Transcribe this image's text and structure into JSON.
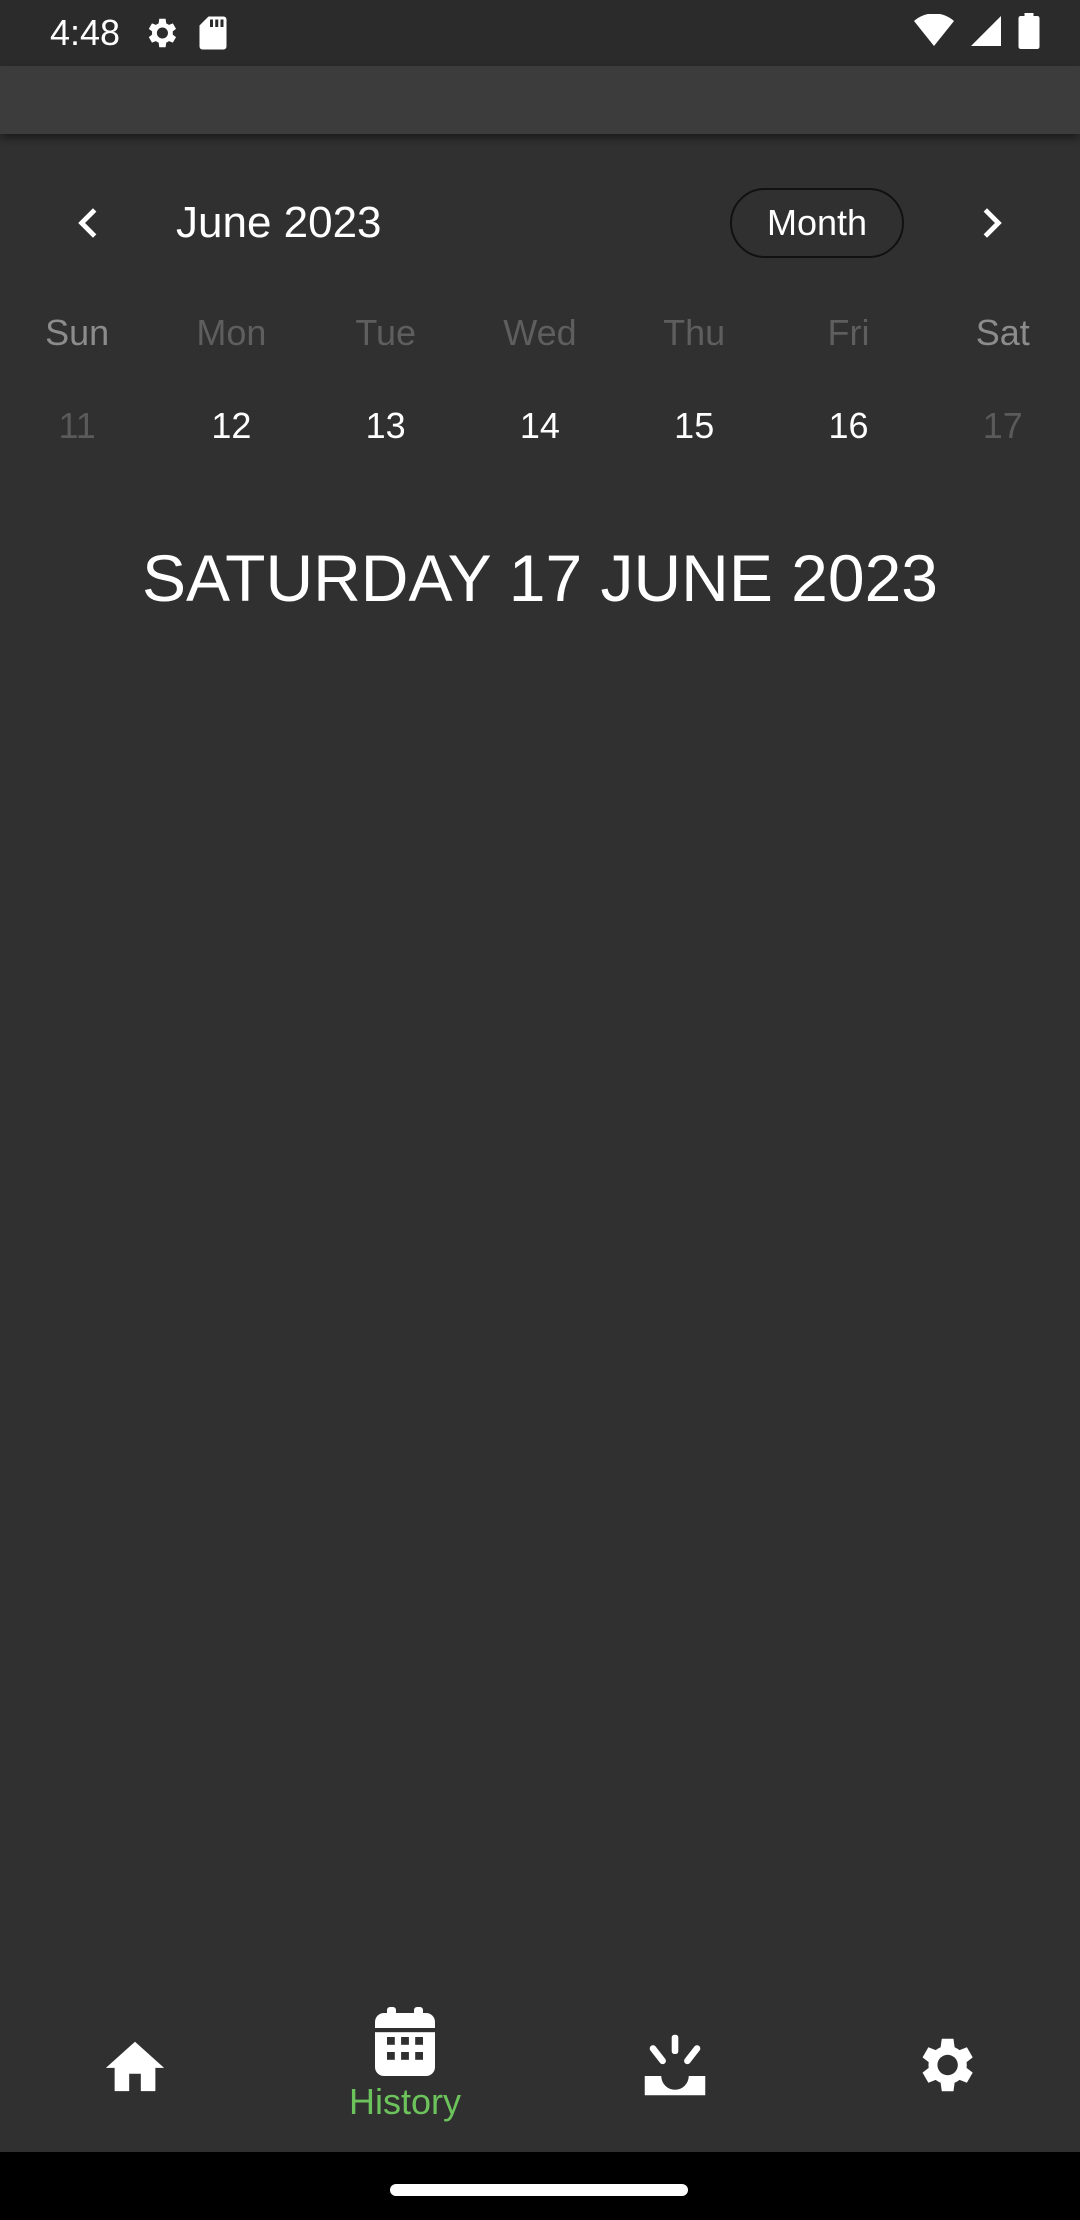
{
  "status_bar": {
    "time": "4:48",
    "icons_left": [
      "settings-gear-icon",
      "sd-card-icon"
    ],
    "icons_right": [
      "wifi-icon",
      "cellular-signal-icon",
      "battery-icon"
    ]
  },
  "calendar": {
    "month_title": "June 2023",
    "format_button": "Month",
    "weekdays": [
      "Sun",
      "Mon",
      "Tue",
      "Wed",
      "Thu",
      "Fri",
      "Sat"
    ],
    "dates": [
      "11",
      "12",
      "13",
      "14",
      "15",
      "16",
      "17"
    ]
  },
  "selected_day_heading": "SATURDAY 17 JUNE 2023",
  "bottom_nav": {
    "items": [
      {
        "icon": "home-icon",
        "label": ""
      },
      {
        "icon": "calendar-icon",
        "label": "History",
        "active": true
      },
      {
        "icon": "alarm-light-icon",
        "label": ""
      },
      {
        "icon": "settings-icon",
        "label": ""
      }
    ]
  },
  "colors": {
    "background": "#303030",
    "app_bar": "#3c3c3c",
    "active_accent": "#6cc35c",
    "text_primary": "#ffffff",
    "text_dim": "#5a5a5a"
  }
}
